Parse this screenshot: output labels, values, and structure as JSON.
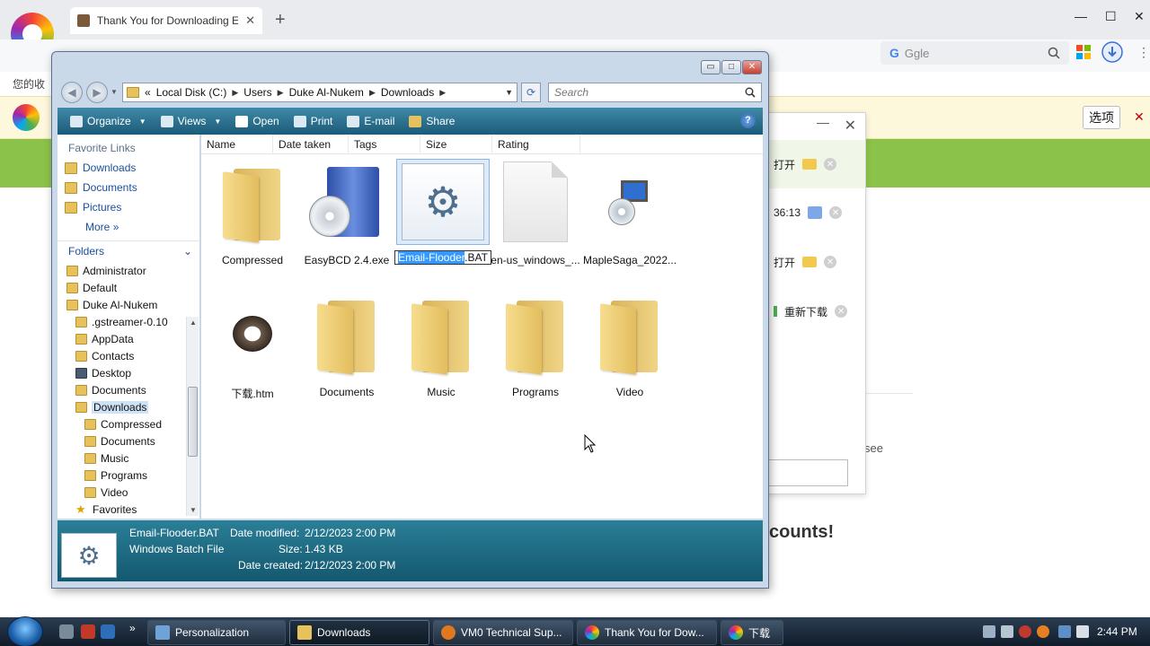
{
  "browser": {
    "tab_title": "Thank You for Downloading E",
    "tab_close": "✕",
    "new_tab": "+",
    "minimize": "—",
    "maximize": "☐",
    "close": "✕",
    "search_logo": "G",
    "search_placeholder": "Ggle",
    "bookmarks_label": "您的收",
    "notif_options": "选项",
    "notif_close": "✕",
    "page_see": "see",
    "page_accounts": "counts!"
  },
  "downloads_panel": {
    "min": "—",
    "close": "✕",
    "rows": [
      {
        "text": "打开"
      },
      {
        "text": "36:13"
      },
      {
        "text": "打开"
      },
      {
        "text": "重新下载"
      }
    ],
    "x": "✕"
  },
  "explorer": {
    "caption": {
      "min": "▭",
      "max": "□",
      "close": "✕"
    },
    "address": {
      "segments": [
        "«",
        "Local Disk (C:)",
        "Users",
        "Duke Al-Nukem",
        "Downloads"
      ],
      "chevron": "▶",
      "dropdown": "▼"
    },
    "search_placeholder": "Search",
    "toolbar": {
      "organize": "Organize",
      "views": "Views",
      "open": "Open",
      "print": "Print",
      "email": "E-mail",
      "share": "Share",
      "help": "?"
    },
    "left_pane": {
      "favorite_links_title": "Favorite Links",
      "favorites": [
        "Downloads",
        "Documents",
        "Pictures"
      ],
      "more": "More",
      "more_arrow": "»",
      "folders_title": "Folders",
      "folders_caret": "⌄",
      "tree": [
        {
          "label": "Administrator",
          "indent": 0
        },
        {
          "label": "Default",
          "indent": 0
        },
        {
          "label": "Duke Al-Nukem",
          "indent": 0
        },
        {
          "label": ".gstreamer-0.10",
          "indent": 1
        },
        {
          "label": "AppData",
          "indent": 1
        },
        {
          "label": "Contacts",
          "indent": 1
        },
        {
          "label": "Desktop",
          "indent": 1
        },
        {
          "label": "Documents",
          "indent": 1
        },
        {
          "label": "Downloads",
          "indent": 1,
          "selected": true
        },
        {
          "label": "Compressed",
          "indent": 2
        },
        {
          "label": "Documents",
          "indent": 2
        },
        {
          "label": "Music",
          "indent": 2
        },
        {
          "label": "Programs",
          "indent": 2
        },
        {
          "label": "Video",
          "indent": 2
        },
        {
          "label": "Favorites",
          "indent": 1
        }
      ]
    },
    "columns": [
      "Name",
      "Date taken",
      "Tags",
      "Size",
      "Rating"
    ],
    "files": [
      {
        "name": "Compressed",
        "icon": "folder-icon"
      },
      {
        "name": "EasyBCD 2.4.exe",
        "icon": "installer-disc-icon"
      },
      {
        "name_selected_part": "Email-Flooder",
        "name_rest": ".BAT",
        "icon": "batch-gear-icon",
        "selected": true,
        "renaming": true
      },
      {
        "name": "en-us_windows_...",
        "icon": "blank-file-icon"
      },
      {
        "name": "MapleSaga_2022...",
        "icon": "setup-icon"
      },
      {
        "name": "下载.htm",
        "icon": "raccoon-icon"
      },
      {
        "name": "Documents",
        "icon": "folder-icon"
      },
      {
        "name": "Music",
        "icon": "folder-icon"
      },
      {
        "name": "Programs",
        "icon": "folder-icon"
      },
      {
        "name": "Video",
        "icon": "folder-icon"
      }
    ],
    "details": {
      "file_name": "Email-Flooder.BAT",
      "file_type": "Windows Batch File",
      "date_modified_label": "Date modified:",
      "date_modified": "2/12/2023 2:00 PM",
      "size_label": "Size:",
      "size": "1.43 KB",
      "date_created_label": "Date created:",
      "date_created": "2/12/2023 2:00 PM"
    }
  },
  "taskbar": {
    "buttons": [
      {
        "label": "Personalization",
        "icon": "personalization-icon"
      },
      {
        "label": "Downloads",
        "icon": "folder-icon",
        "active": true
      },
      {
        "label": "VM0 Technical Sup...",
        "icon": "firefox-icon"
      },
      {
        "label": "Thank You for Dow...",
        "icon": "browser-icon"
      },
      {
        "label": "下载",
        "icon": "browser-icon"
      }
    ],
    "quicklaunch_arrow": "»",
    "clock": "2:44 PM"
  }
}
